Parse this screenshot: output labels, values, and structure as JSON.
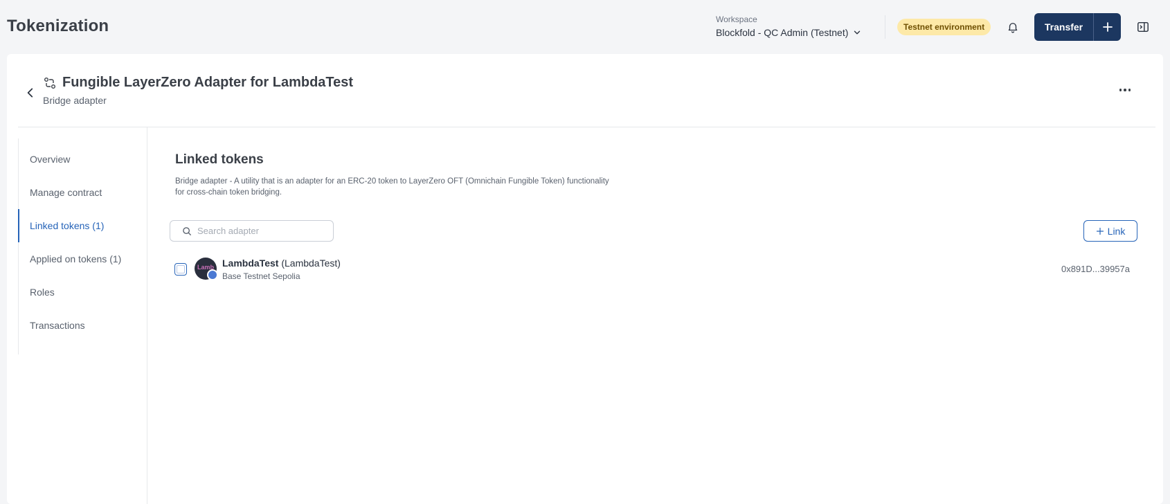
{
  "header": {
    "app_title": "Tokenization",
    "workspace_label": "Workspace",
    "workspace_value": "Blockfold - QC Admin (Testnet)",
    "environment_badge": "Testnet environment",
    "transfer_label": "Transfer"
  },
  "page": {
    "title": "Fungible LayerZero Adapter for LambdaTest",
    "subtitle": "Bridge adapter"
  },
  "sidebar": {
    "items": [
      {
        "label": "Overview",
        "active": false
      },
      {
        "label": "Manage contract",
        "active": false
      },
      {
        "label": "Linked tokens (1)",
        "active": true
      },
      {
        "label": "Applied on tokens (1)",
        "active": false
      },
      {
        "label": "Roles",
        "active": false
      },
      {
        "label": "Transactions",
        "active": false
      }
    ]
  },
  "content": {
    "section_title": "Linked tokens",
    "description": "Bridge adapter - A utility that is an adapter for an ERC-20 token to LayerZero OFT (Omnichain Fungible Token) functionality for cross-chain token bridging.",
    "search_placeholder": "Search adapter",
    "link_button": "Link",
    "tokens": [
      {
        "name": "LambdaTest",
        "symbol": "(LambdaTest)",
        "network": "Base Testnet Sepolia",
        "address": "0x891D...39957a",
        "avatar_text": "Lamb"
      }
    ]
  },
  "colors": {
    "primary": "#1c3760",
    "accent": "#2563b8",
    "badge_bg": "#fde9a8"
  }
}
